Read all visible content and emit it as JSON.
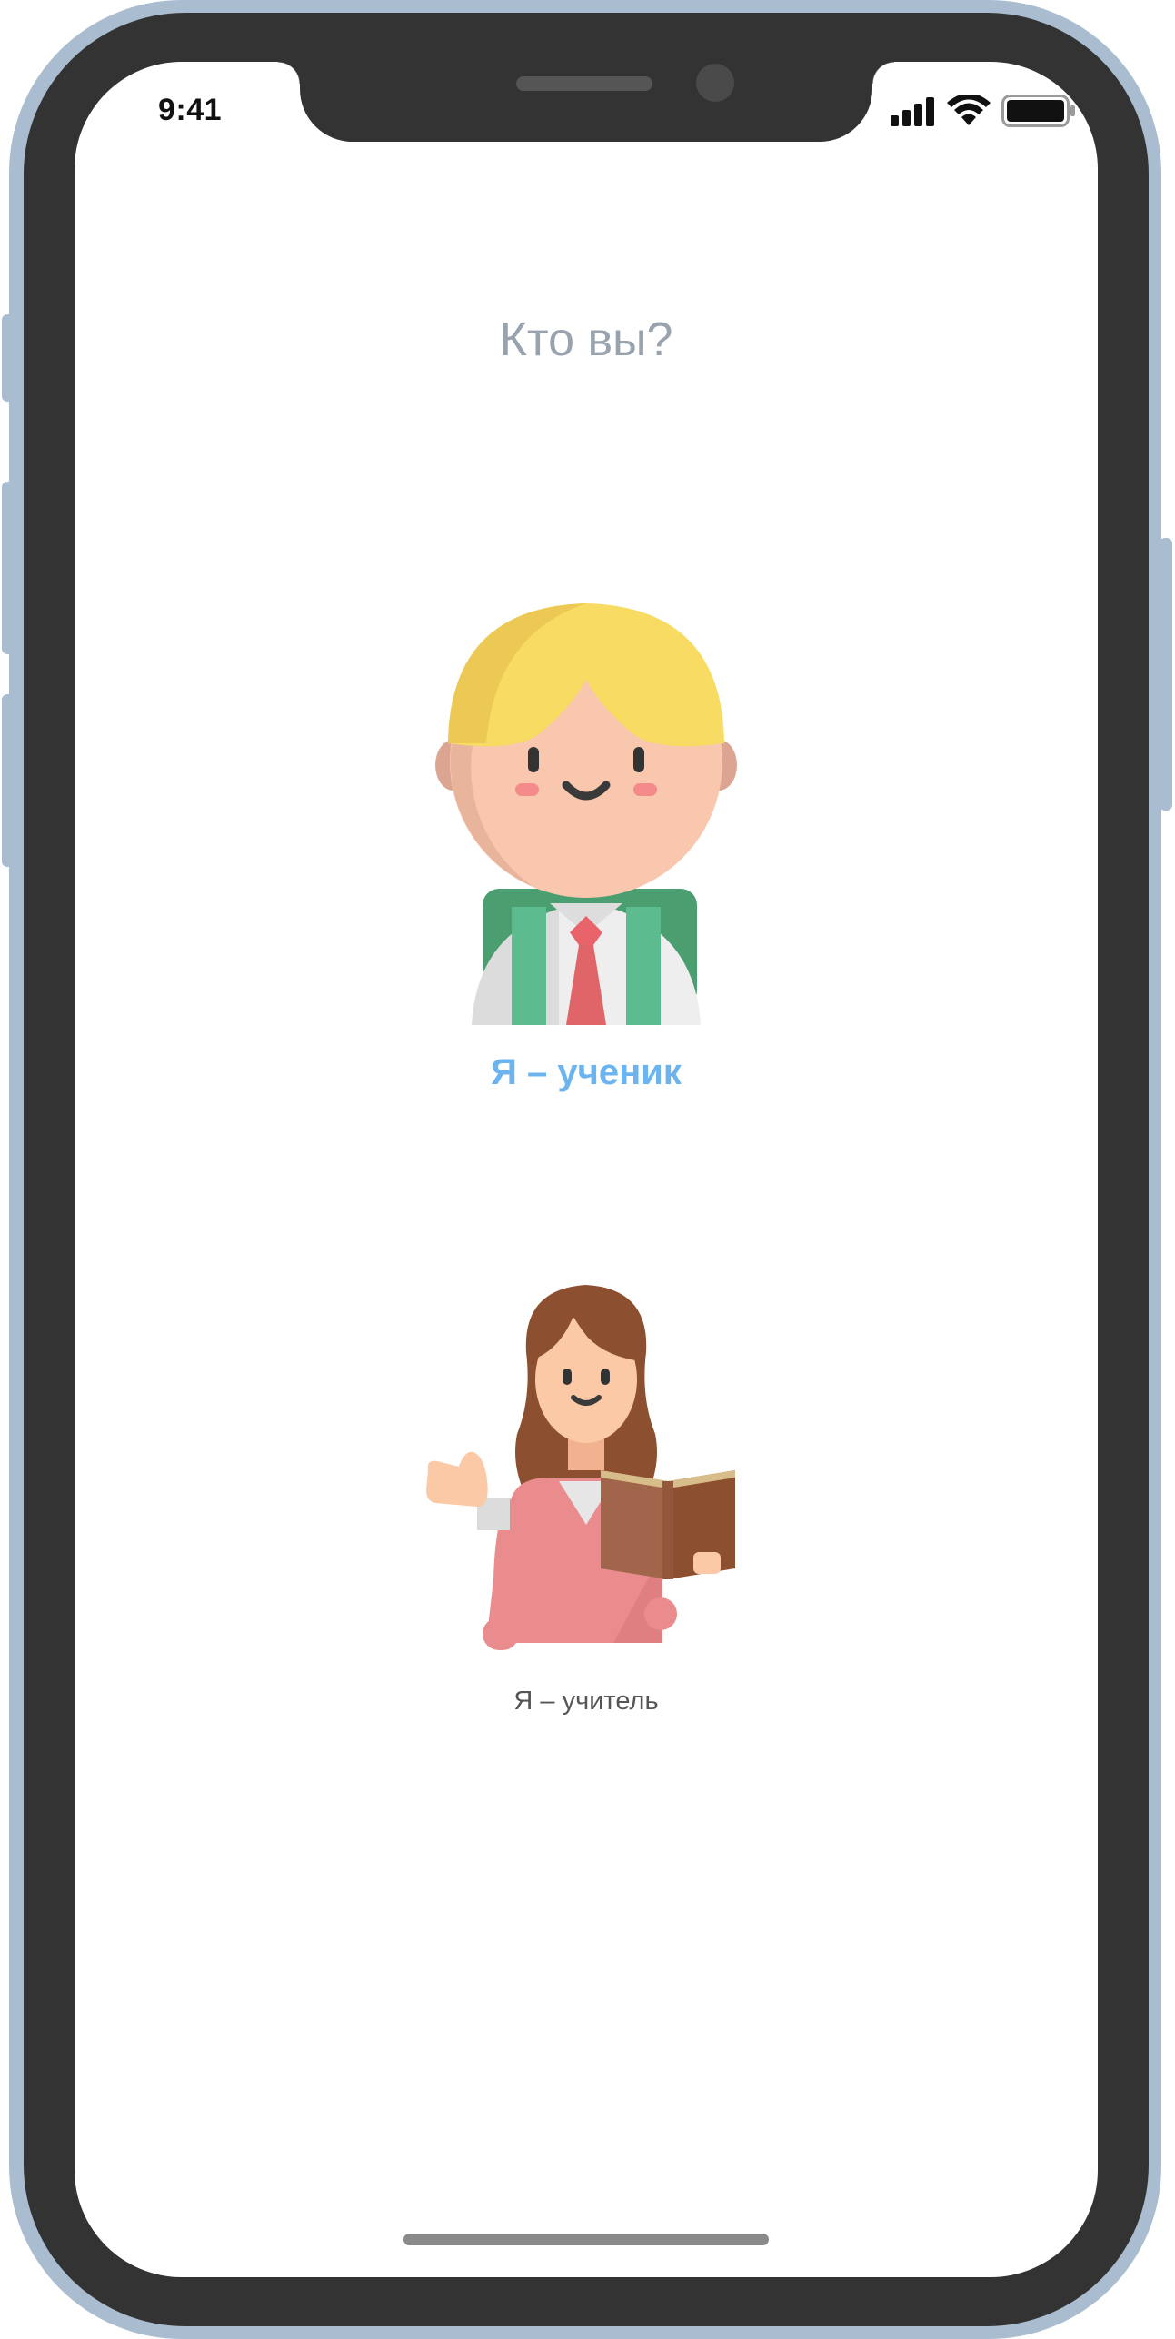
{
  "status_bar": {
    "time": "9:41",
    "icons": [
      "signal-icon",
      "wifi-icon",
      "battery-icon"
    ]
  },
  "screen": {
    "title": "Кто вы?",
    "roles": [
      {
        "label": "Я – ученик",
        "icon": "student-avatar-icon",
        "selected": true
      },
      {
        "label": "Я – учитель",
        "icon": "teacher-avatar-icon",
        "selected": false
      }
    ]
  },
  "colors": {
    "frame": "#aabdd0",
    "bezel": "#333333",
    "title": "#99a3ae",
    "selected_label": "#6cb4ef",
    "label": "#555555"
  }
}
